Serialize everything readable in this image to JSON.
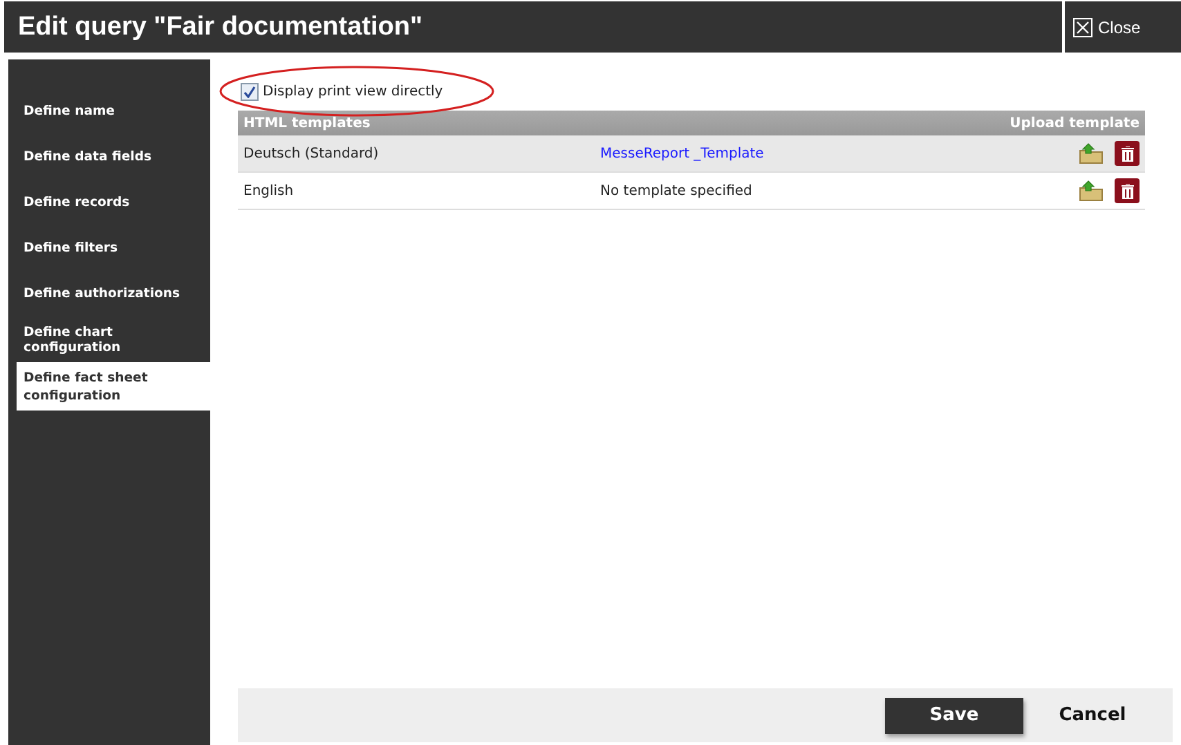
{
  "window": {
    "title": "Edit query \"Fair documentation\"",
    "close_label": "Close"
  },
  "sidebar": {
    "items": [
      {
        "label": "Define name",
        "selected": false
      },
      {
        "label": "Define data fields",
        "selected": false
      },
      {
        "label": "Define records",
        "selected": false
      },
      {
        "label": "Define filters",
        "selected": false
      },
      {
        "label": "Define authorizations",
        "selected": false
      },
      {
        "label": "Define chart configuration",
        "selected": false
      },
      {
        "label": "Define fact sheet configuration",
        "selected": true
      }
    ]
  },
  "option": {
    "label": "Display print view directly",
    "checked": true,
    "highlighted": true
  },
  "table": {
    "columns": [
      "HTML templates",
      "Upload template"
    ],
    "rows": [
      {
        "language": "Deutsch (Standard)",
        "template": "MesseReport _Template",
        "kind": "link"
      },
      {
        "language": "English",
        "template": "No template specified",
        "kind": "text"
      }
    ]
  },
  "buttons": {
    "save": "Save",
    "cancel": "Cancel"
  }
}
